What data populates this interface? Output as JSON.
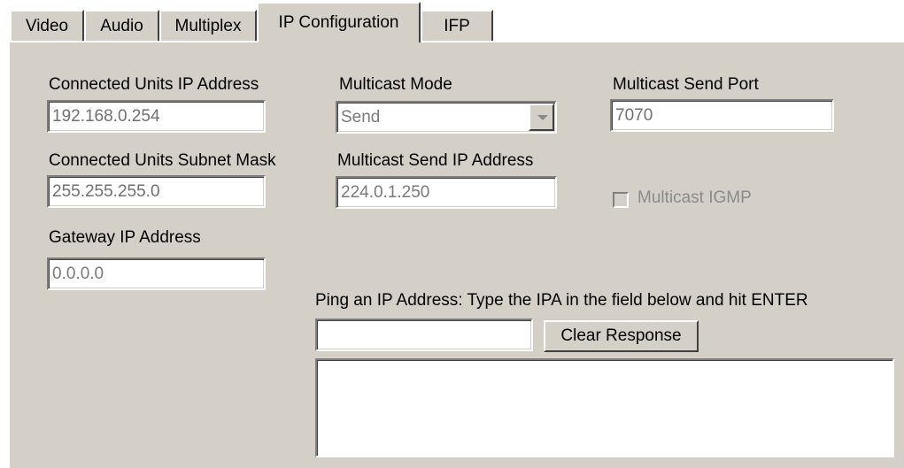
{
  "tabs": [
    {
      "label": "Video"
    },
    {
      "label": "Audio"
    },
    {
      "label": "Multiplex"
    },
    {
      "label": "IP Configuration",
      "active": true
    },
    {
      "label": "IFP"
    }
  ],
  "ip_config": {
    "connected_ip": {
      "label": "Connected Units IP Address",
      "value": "192.168.0.254"
    },
    "subnet_mask": {
      "label": "Connected Units Subnet Mask",
      "value": "255.255.255.0"
    },
    "gateway": {
      "label": "Gateway IP Address",
      "value": "0.0.0.0"
    },
    "multicast_mode": {
      "label": "Multicast Mode",
      "value": "Send"
    },
    "multicast_send_ip": {
      "label": "Multicast Send IP Address",
      "value": "224.0.1.250"
    },
    "multicast_send_port": {
      "label": "Multicast Send Port",
      "value": "7070"
    },
    "multicast_igmp": {
      "label": "Multicast IGMP",
      "checked": false,
      "enabled": false
    },
    "ping": {
      "label": "Ping an IP Address: Type the IPA in the field below and hit ENTER",
      "input_value": "",
      "clear_button": "Clear Response",
      "response": ""
    }
  }
}
